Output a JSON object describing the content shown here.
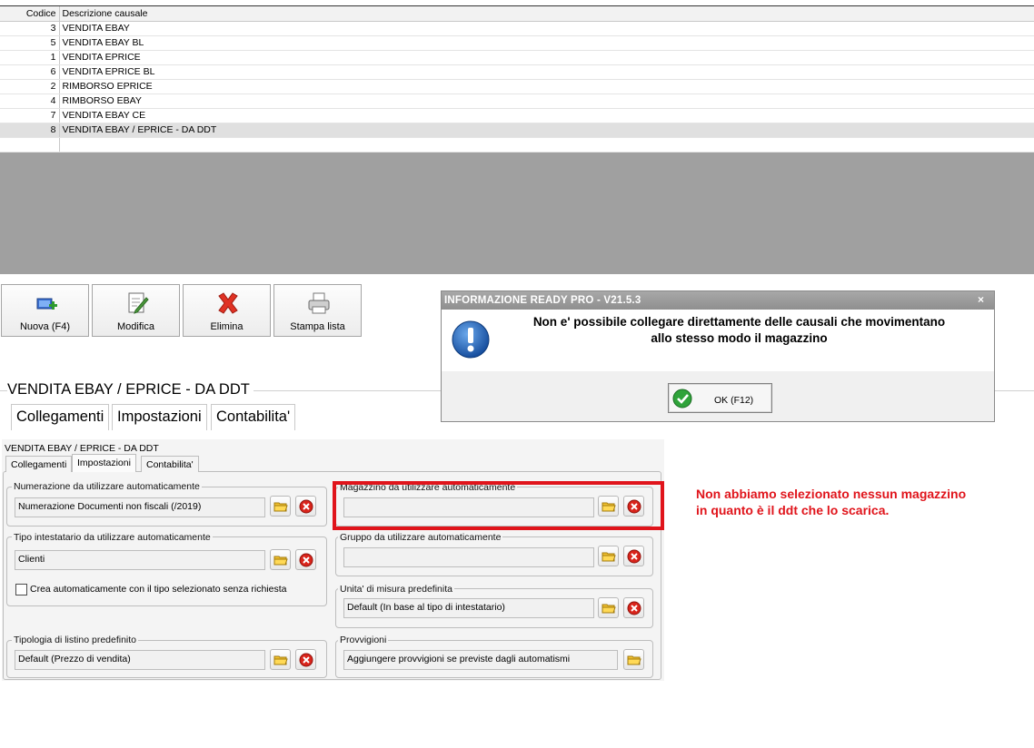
{
  "grid": {
    "headers": {
      "code": "Codice",
      "description": "Descrizione causale"
    },
    "rows": [
      {
        "code": "3",
        "description": "VENDITA EBAY"
      },
      {
        "code": "5",
        "description": "VENDITA EBAY BL"
      },
      {
        "code": "1",
        "description": "VENDITA EPRICE"
      },
      {
        "code": "6",
        "description": "VENDITA EPRICE BL"
      },
      {
        "code": "2",
        "description": "RIMBORSO EPRICE"
      },
      {
        "code": "4",
        "description": "RIMBORSO EBAY"
      },
      {
        "code": "7",
        "description": "VENDITA EBAY CE"
      },
      {
        "code": "8",
        "description": "VENDITA EBAY / EPRICE - DA DDT"
      }
    ]
  },
  "toolbar": {
    "new_label": "Nuova (F4)",
    "edit_label": "Modifica",
    "delete_label": "Elimina",
    "print_label": "Stampa lista"
  },
  "detail": {
    "title": "VENDITA EBAY / EPRICE - DA DDT",
    "tabs": [
      "Collegamenti",
      "Impostazioni",
      "Contabilita'"
    ]
  },
  "embedded": {
    "title": "VENDITA EBAY / EPRICE - DA DDT",
    "tabs": [
      "Collegamenti",
      "Impostazioni",
      "Contabilita'"
    ],
    "numerazione": {
      "label": "Numerazione da utilizzare automaticamente",
      "value": "Numerazione Documenti non fiscali (/2019)"
    },
    "tipo_intestatario": {
      "label": "Tipo intestatario da utilizzare automaticamente",
      "value": "Clienti"
    },
    "crea_auto": {
      "label": "Crea automaticamente con il tipo selezionato senza richiesta",
      "checked": false
    },
    "tipologia_listino": {
      "label": "Tipologia di listino predefinito",
      "value": "Default (Prezzo di vendita)"
    },
    "magazzino": {
      "label": "Magazzino da utilizzare automaticamente",
      "value": ""
    },
    "gruppo": {
      "label": "Gruppo da utilizzare automaticamente",
      "value": ""
    },
    "unita_misura": {
      "label": "Unita' di misura predefinita",
      "value": "Default (In base al tipo di intestatario)"
    },
    "provvigioni": {
      "label": "Provvigioni",
      "value": "Aggiungere provvigioni se previste dagli automatismi"
    }
  },
  "dialog": {
    "title": "INFORMAZIONE READY PRO - V21.5.3",
    "close_glyph": "×",
    "message_line1": "Non e' possibile collegare direttamente delle causali che movimentano",
    "message_line2": "allo stesso modo il magazzino",
    "ok_label": "OK (F12)"
  },
  "annotation": {
    "line1": "Non abbiamo selezionato nessun magazzino",
    "line2": "in quanto è il ddt che lo scarica."
  },
  "icons": {
    "new": "add-document-icon",
    "edit": "edit-document-icon",
    "delete": "red-x-icon",
    "print": "printer-icon",
    "browse": "folder-icon",
    "clear": "clear-icon",
    "info": "exclamation-info-icon",
    "ok": "green-check-icon"
  },
  "colors": {
    "annotation_red": "#e0141b",
    "dialog_blue": "#1a5fb4"
  }
}
